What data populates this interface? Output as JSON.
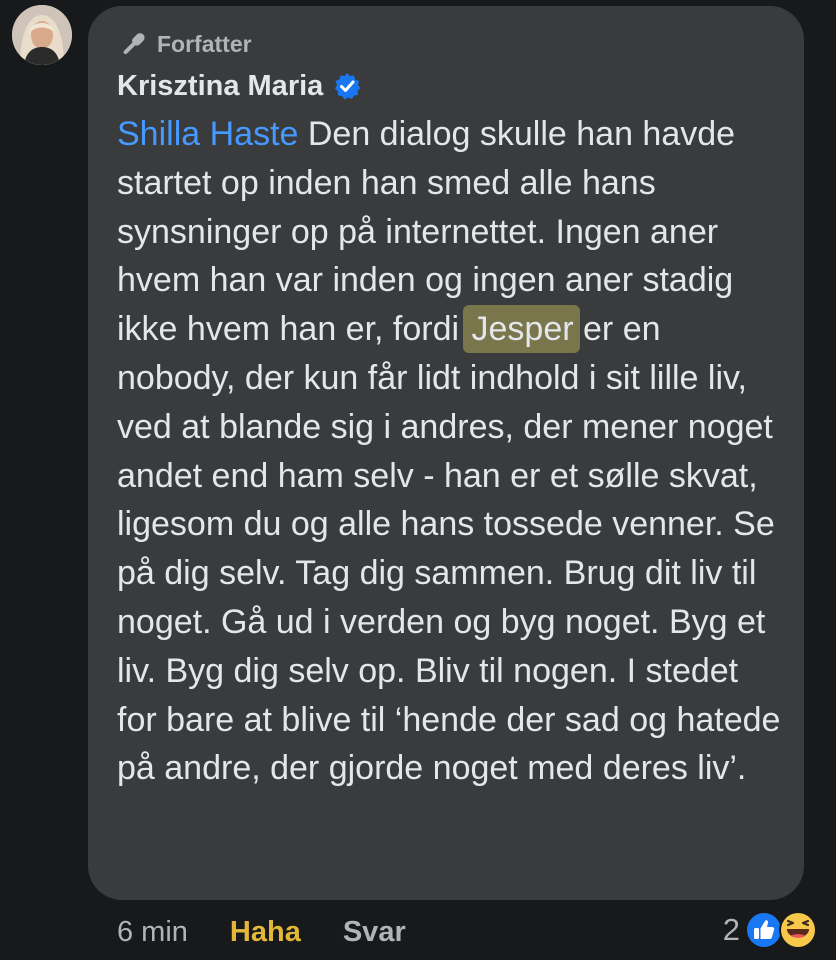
{
  "comment": {
    "role_label": "Forfatter",
    "author": "Krisztina Maria",
    "mention": "Shilla Haste",
    "text_before_highlight": " Den dialog skulle han havde startet op inden han smed alle hans synsninger op på internettet. Ingen aner hvem han var inden og ingen aner stadig ikke hvem han er, fordi ",
    "highlight": "Jesper",
    "text_after_highlight": " er en nobody, der kun får lidt indhold i sit lille liv, ved at blande sig i andres, der mener noget andet end ham selv - han er et sølle skvat, ligesom du og alle hans tossede venner. Se på dig selv. Tag dig sammen. Brug dit liv til noget. Gå ud i verden og byg noget. Byg et liv. Byg dig selv op. Bliv til nogen. I stedet for bare at blive til ‘hende der sad og hatede på andre, der gjorde noget med deres liv’."
  },
  "actions": {
    "time": "6 min",
    "reaction_label": "Haha",
    "reply_label": "Svar"
  },
  "reactions": {
    "count": "2",
    "icons": [
      "like-icon",
      "haha-emoji-icon"
    ]
  },
  "colors": {
    "background": "#18191a",
    "bubble": "#3a3b3c",
    "mention": "#4599ff",
    "highlight": "#78764a",
    "haha": "#e2b73a",
    "verified": "#1877f2"
  }
}
